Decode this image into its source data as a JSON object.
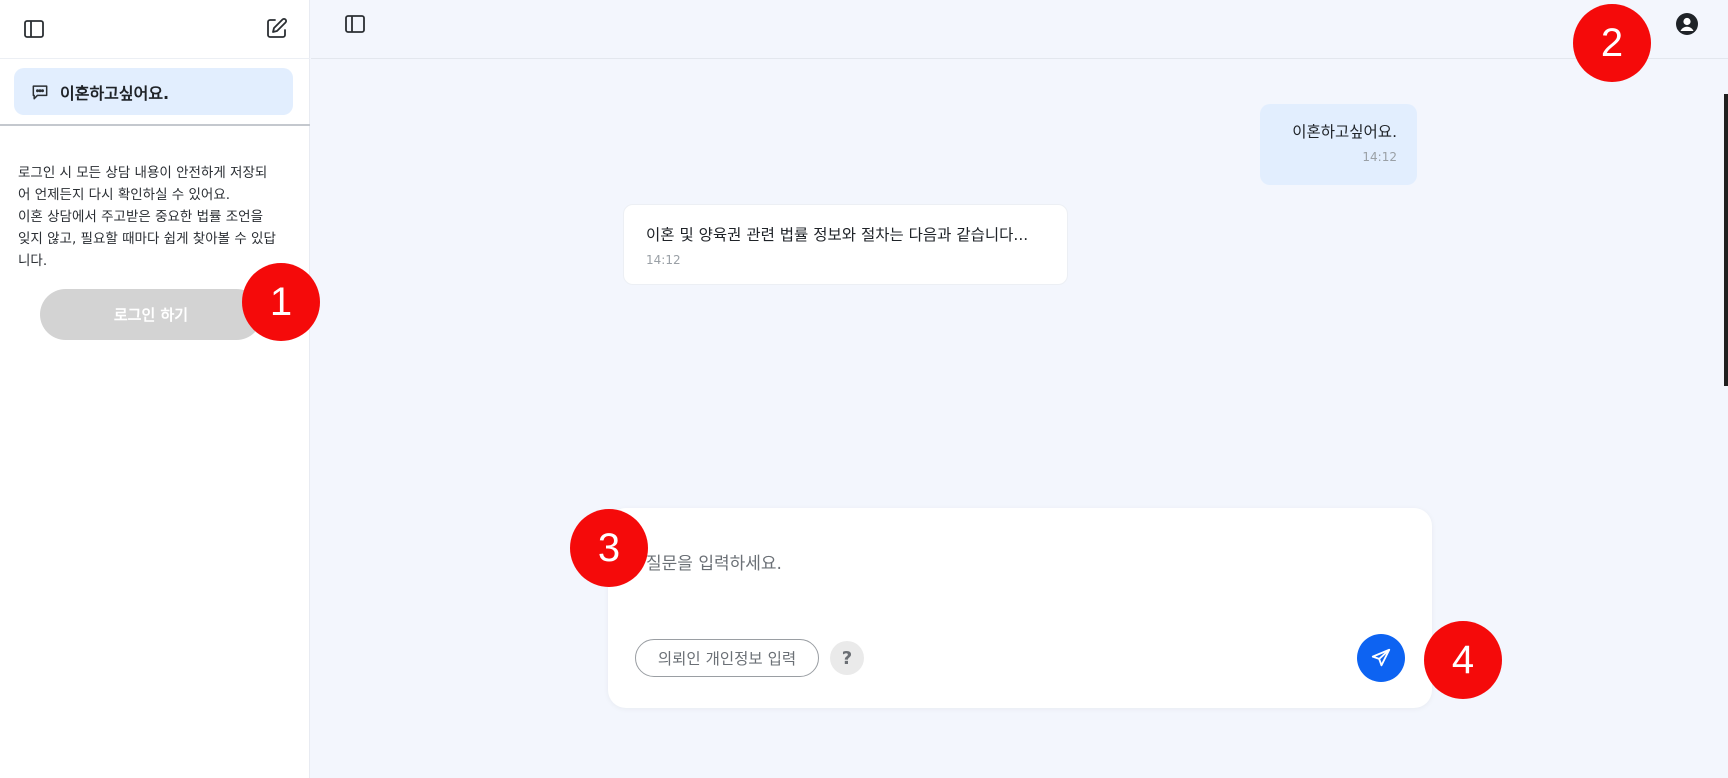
{
  "sidebar": {
    "history": [
      {
        "label": "이혼하고싶어요."
      }
    ],
    "login_note": "로그인 시 모든 상담 내용이 안전하게 저장되\n어 언제든지 다시 확인하실 수 있어요.\n이혼 상담에서 주고받은 중요한 법률 조언을\n잊지 않고, 필요할 때마다 쉽게 찾아볼 수 있답\n니다.",
    "login_button": "로그인 하기"
  },
  "chat": {
    "messages": [
      {
        "role": "user",
        "text": "이혼하고싶어요.",
        "time": "14:12"
      },
      {
        "role": "assistant",
        "text": "이혼 및 양육권 관련 법률 정보와 절차는 다음과 같습니다...",
        "time": "14:12"
      }
    ]
  },
  "composer": {
    "placeholder": "질문을 입력하세요.",
    "pii_button": "의뢰인 개인정보 입력",
    "help_label": "?"
  },
  "markers": [
    "1",
    "2",
    "3",
    "4"
  ],
  "colors": {
    "accent": "#0d63f2",
    "marker": "#f50a0a",
    "bubble_user": "#e2eefe",
    "background": "#f3f6fd"
  },
  "icons": {
    "sidebar_toggle": "sidebar-toggle-icon",
    "new_chat": "edit-icon",
    "chat_item": "chat-bubble-icon",
    "profile": "user-circle-icon",
    "send": "send-icon"
  }
}
